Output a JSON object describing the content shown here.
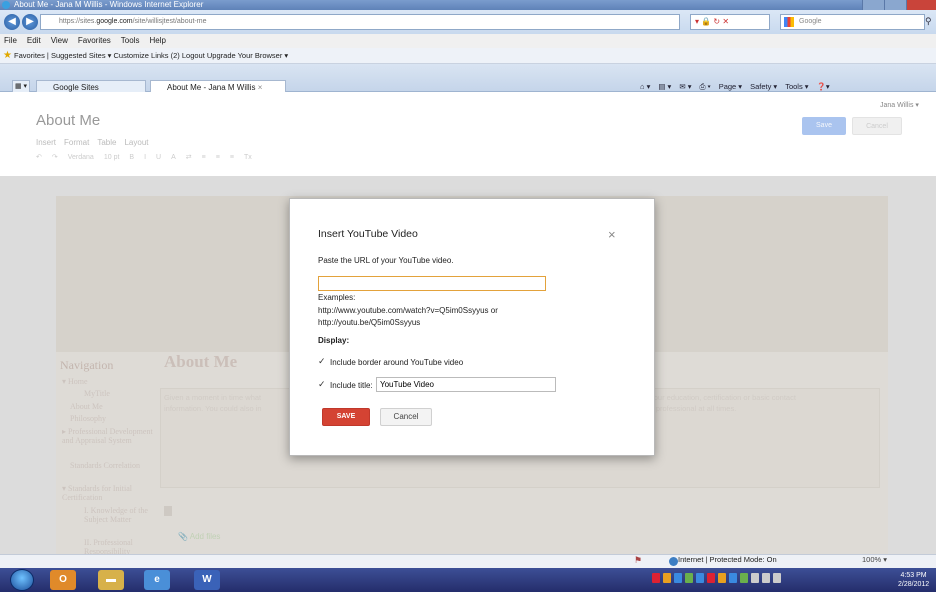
{
  "browser": {
    "window_title": "About Me - Jana M Willis - Windows Internet Explorer",
    "url_prefix": "https://sites.",
    "url_domain": "google.com",
    "url_path": "/site/willisjtest/about-me",
    "search_placeholder": "Google",
    "menu": [
      "File",
      "Edit",
      "View",
      "Favorites",
      "Tools",
      "Help"
    ],
    "favorites_bar": "Favorites  |  Suggested Sites ▾   Customize Links (2)   Logout   Upgrade Your Browser ▾",
    "tabs": [
      {
        "label": "Google Sites",
        "active": false
      },
      {
        "label": "About Me - Jana M Willis",
        "active": true
      }
    ],
    "command_bar": [
      "Page ▾",
      "Safety ▾",
      "Tools ▾"
    ],
    "status_text": "Internet | Protected Mode: On",
    "zoom": "100% ▾"
  },
  "site": {
    "user": "Jana Willis ▾",
    "page_title": "About Me",
    "edit_menu": [
      "Insert",
      "Format",
      "Table",
      "Layout"
    ],
    "save_label": "Save",
    "cancel_label": "Cancel",
    "toolbar": [
      "↶",
      "↷",
      "Verdana",
      "10 pt",
      "B",
      "I",
      "U",
      "A",
      "⇄",
      "≡",
      "≡",
      "≡",
      "Tx"
    ],
    "nav_title": "Navigation",
    "nav_items": [
      "▾ Home",
      "MyTitle",
      "About Me",
      "Philosophy",
      "▸ Professional Development and Appraisal System",
      "Standards Correlation",
      "▾ Standards for Initial Certification",
      "I. Knowledge of the Subject Matter",
      "II. Professional Responsibility"
    ],
    "content_heading": "About Me",
    "intro_line1": "Given a moment in time what",
    "intro_line1b": "your education, certification or basic contact",
    "intro_line2": "information. You could also in",
    "intro_line2b": "y professional at all times.",
    "add_files": "Add files"
  },
  "dialog": {
    "title": "Insert YouTube Video",
    "close": "×",
    "prompt": "Paste the URL of your YouTube video.",
    "url_value": "",
    "examples_label": "Examples:",
    "example1": "http://www.youtube.com/watch?v=Q5im0Ssyyus or",
    "example2": "http://youtu.be/Q5im0Ssyyus",
    "display_label": "Display:",
    "border_label": "Include border around YouTube video",
    "border_checked": true,
    "title_label": "Include title:",
    "title_checked": true,
    "title_value": "YouTube Video",
    "save_label": "SAVE",
    "cancel_label": "Cancel",
    "accent": "#d44333"
  },
  "taskbar": {
    "apps": [
      "Outlook",
      "Files",
      "Internet Explorer",
      "Word"
    ],
    "time": "4:53 PM",
    "date": "2/28/2012"
  }
}
